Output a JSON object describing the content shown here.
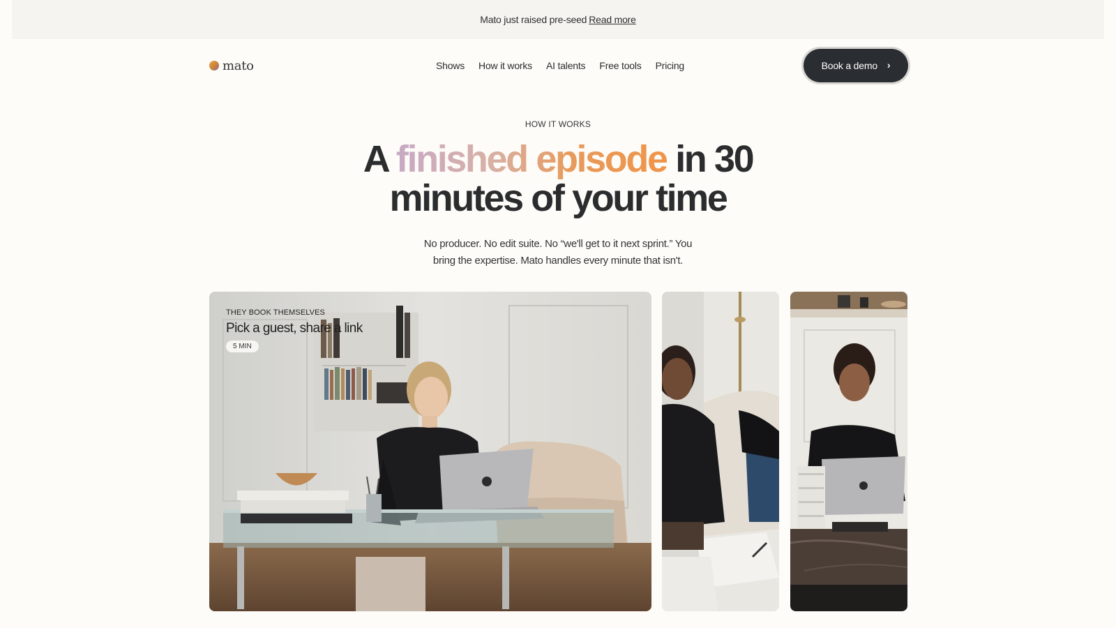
{
  "announcement": {
    "text": "Mato just raised pre-seed",
    "link": "Read more"
  },
  "nav": {
    "logo": "mato",
    "items": [
      "Shows",
      "How it works",
      "AI talents",
      "Free tools",
      "Pricing"
    ],
    "cta": "Book a demo"
  },
  "hero": {
    "eyebrow": "HOW IT WORKS",
    "headline_a": "A ",
    "headline_highlight": "finished episode",
    "headline_b": " in 30",
    "headline_line2": "minutes of your time",
    "subtitle": "No producer. No edit suite. No “we'll get to it next sprint.” You bring the expertise. Mato handles every minute that isn't."
  },
  "cards": [
    {
      "kicker": "THEY BOOK THEMSELVES",
      "title": "Pick a guest, share a link",
      "badge": "5 MIN"
    }
  ],
  "colors": {
    "background": "#fdfcf8",
    "announcement_bg": "#f5f4f1",
    "button_bg": "#2a2d31",
    "gradient_start": "#c7a9c4",
    "gradient_end": "#f0944a"
  }
}
